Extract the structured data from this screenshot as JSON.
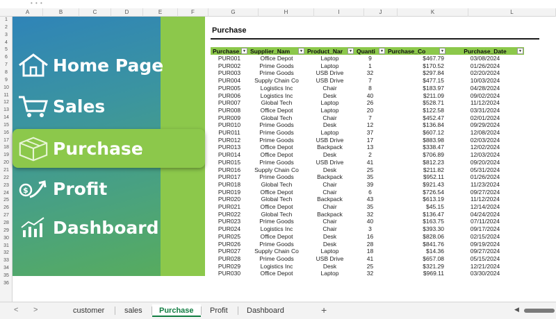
{
  "topbar": {
    "dots": "• • •"
  },
  "columns": [
    "A",
    "B",
    "C",
    "D",
    "E",
    "F",
    "G",
    "H",
    "I",
    "J",
    "K",
    "L"
  ],
  "rows": [
    "1",
    "2",
    "3",
    "4",
    "5",
    "6",
    "7",
    "8",
    "9",
    "10",
    "11",
    "12",
    "13",
    "14",
    "15",
    "16",
    "17",
    "18",
    "19",
    "20",
    "21",
    "22",
    "23",
    "24",
    "25",
    "26",
    "27",
    "28",
    "29",
    "30",
    "31",
    "32",
    "33",
    "34",
    "35",
    "36"
  ],
  "sidebar": {
    "items": [
      {
        "label": "Home Page",
        "icon": "house-icon"
      },
      {
        "label": "Sales",
        "icon": "cart-icon"
      },
      {
        "label": "Purchase",
        "icon": "box-icon",
        "active": true
      },
      {
        "label": "Profit",
        "icon": "money-up-icon"
      },
      {
        "label": "Dashboard",
        "icon": "bar-chart-icon"
      }
    ],
    "colors": {
      "gradient_top": "#2f84b8",
      "gradient_bottom": "#59ad5a",
      "accent": "#8cc84b"
    }
  },
  "sheet": {
    "title": "Purchase",
    "headers": [
      "Purchase_",
      "Supplier_Nam",
      "Product_Nar",
      "Quanti",
      "Purchase_Co",
      "Purchase_Date"
    ],
    "filter_glyph": "▾",
    "rows": [
      [
        "PUR001",
        "Office Depot",
        "Laptop",
        "9",
        "$467.79",
        "03/08/2024"
      ],
      [
        "PUR002",
        "Prime Goods",
        "Laptop",
        "1",
        "$170.52",
        "01/26/2024"
      ],
      [
        "PUR003",
        "Prime Goods",
        "USB Drive",
        "32",
        "$297.84",
        "02/20/2024"
      ],
      [
        "PUR004",
        "Supply Chain Co",
        "USB Drive",
        "7",
        "$477.15",
        "10/03/2024"
      ],
      [
        "PUR005",
        "Logistics Inc",
        "Chair",
        "8",
        "$183.97",
        "04/28/2024"
      ],
      [
        "PUR006",
        "Logistics Inc",
        "Desk",
        "40",
        "$211.09",
        "09/02/2024"
      ],
      [
        "PUR007",
        "Global Tech",
        "Laptop",
        "26",
        "$528.71",
        "11/12/2024"
      ],
      [
        "PUR008",
        "Office Depot",
        "Laptop",
        "20",
        "$122.58",
        "03/31/2024"
      ],
      [
        "PUR009",
        "Global Tech",
        "Chair",
        "7",
        "$452.47",
        "02/01/2024"
      ],
      [
        "PUR010",
        "Prime Goods",
        "Desk",
        "12",
        "$136.84",
        "09/29/2024"
      ],
      [
        "PUR011",
        "Prime Goods",
        "Laptop",
        "37",
        "$607.12",
        "12/08/2024"
      ],
      [
        "PUR012",
        "Prime Goods",
        "USB Drive",
        "17",
        "$883.98",
        "02/03/2024"
      ],
      [
        "PUR013",
        "Office Depot",
        "Backpack",
        "13",
        "$338.47",
        "12/02/2024"
      ],
      [
        "PUR014",
        "Office Depot",
        "Desk",
        "2",
        "$706.89",
        "12/03/2024"
      ],
      [
        "PUR015",
        "Prime Goods",
        "USB Drive",
        "41",
        "$812.23",
        "09/20/2024"
      ],
      [
        "PUR016",
        "Supply Chain Co",
        "Desk",
        "25",
        "$211.82",
        "05/31/2024"
      ],
      [
        "PUR017",
        "Prime Goods",
        "Backpack",
        "35",
        "$952.11",
        "01/26/2024"
      ],
      [
        "PUR018",
        "Global Tech",
        "Chair",
        "39",
        "$921.43",
        "11/23/2024"
      ],
      [
        "PUR019",
        "Office Depot",
        "Chair",
        "6",
        "$726.54",
        "09/27/2024"
      ],
      [
        "PUR020",
        "Global Tech",
        "Backpack",
        "43",
        "$613.19",
        "11/12/2024"
      ],
      [
        "PUR021",
        "Office Depot",
        "Chair",
        "35",
        "$45.15",
        "12/14/2024"
      ],
      [
        "PUR022",
        "Global Tech",
        "Backpack",
        "32",
        "$136.47",
        "04/24/2024"
      ],
      [
        "PUR023",
        "Prime Goods",
        "Chair",
        "40",
        "$163.75",
        "07/11/2024"
      ],
      [
        "PUR024",
        "Logistics Inc",
        "Chair",
        "3",
        "$393.30",
        "09/17/2024"
      ],
      [
        "PUR025",
        "Office Depot",
        "Desk",
        "16",
        "$828.06",
        "02/15/2024"
      ],
      [
        "PUR026",
        "Prime Goods",
        "Desk",
        "28",
        "$841.76",
        "09/19/2024"
      ],
      [
        "PUR027",
        "Supply Chain Co",
        "Laptop",
        "18",
        "$14.36",
        "09/27/2024"
      ],
      [
        "PUR028",
        "Prime Goods",
        "USB Drive",
        "41",
        "$657.08",
        "05/15/2024"
      ],
      [
        "PUR029",
        "Logistics Inc",
        "Desk",
        "25",
        "$321.29",
        "12/21/2024"
      ],
      [
        "PUR030",
        "Office Depot",
        "Laptop",
        "32",
        "$969.11",
        "03/30/2024"
      ]
    ]
  },
  "tabs": {
    "prev": "<",
    "next": ">",
    "items": [
      "customer",
      "sales",
      "Purchase",
      "Profit",
      "Dashboard"
    ],
    "active": "Purchase",
    "add": "+"
  }
}
